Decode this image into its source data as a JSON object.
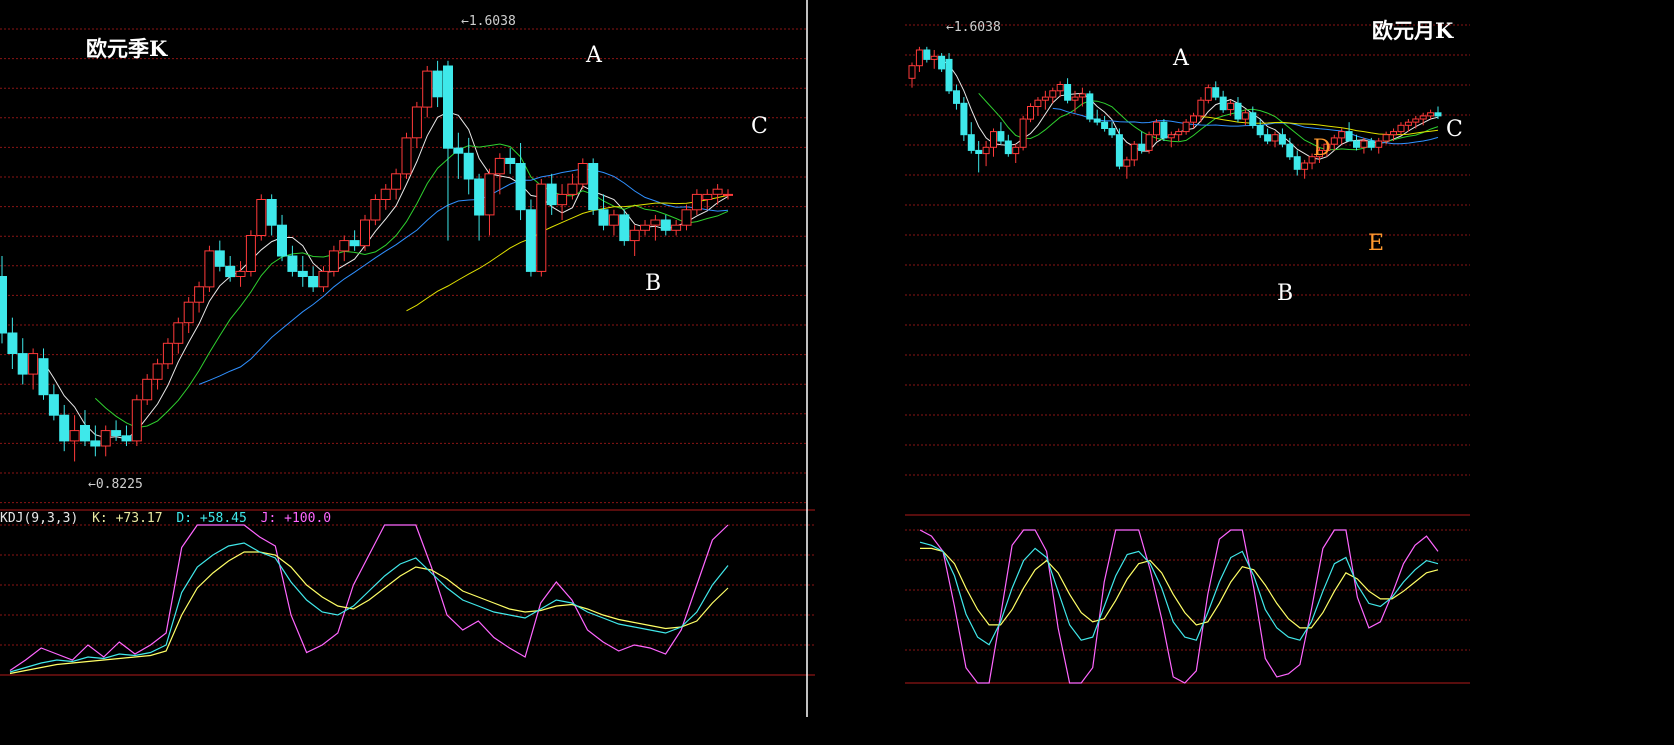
{
  "colors": {
    "up": "#ff3a3a",
    "down": "#3ee8ea",
    "ma5": "#e8e8e8",
    "ma10": "#f0f000",
    "ma20": "#2fd02f",
    "ma30": "#2f90ff",
    "ma60": "#e0e000",
    "k": "#e8e8e8",
    "d": "#ffff66",
    "j": "#ff66ff",
    "grid": "#8a1515",
    "divider": "#ffffff",
    "annot": "#ffffff",
    "annot_orange": "#ff9a2e"
  },
  "chart_data": [
    {
      "type": "candlestick",
      "title": "欧元季K",
      "price_high_label": "1.6038",
      "price_low_label": "0.8225",
      "ylim": [
        0.78,
        1.66
      ],
      "candles": [
        [
          1.18,
          1.22,
          1.05,
          1.07
        ],
        [
          1.07,
          1.1,
          1.0,
          1.03
        ],
        [
          1.03,
          1.06,
          0.97,
          0.99
        ],
        [
          0.99,
          1.04,
          0.96,
          1.03
        ],
        [
          1.02,
          1.04,
          0.94,
          0.95
        ],
        [
          0.95,
          0.97,
          0.9,
          0.91
        ],
        [
          0.91,
          0.93,
          0.84,
          0.86
        ],
        [
          0.86,
          0.91,
          0.82,
          0.88
        ],
        [
          0.89,
          0.92,
          0.85,
          0.86
        ],
        [
          0.86,
          0.89,
          0.83,
          0.85
        ],
        [
          0.85,
          0.89,
          0.83,
          0.88
        ],
        [
          0.88,
          0.9,
          0.86,
          0.87
        ],
        [
          0.87,
          0.89,
          0.85,
          0.86
        ],
        [
          0.86,
          0.95,
          0.85,
          0.94
        ],
        [
          0.94,
          0.99,
          0.93,
          0.98
        ],
        [
          0.98,
          1.02,
          0.96,
          1.01
        ],
        [
          1.01,
          1.06,
          1.0,
          1.05
        ],
        [
          1.05,
          1.1,
          1.03,
          1.09
        ],
        [
          1.09,
          1.14,
          1.07,
          1.13
        ],
        [
          1.13,
          1.17,
          1.11,
          1.16
        ],
        [
          1.16,
          1.24,
          1.15,
          1.23
        ],
        [
          1.23,
          1.25,
          1.19,
          1.2
        ],
        [
          1.2,
          1.22,
          1.17,
          1.18
        ],
        [
          1.18,
          1.21,
          1.16,
          1.19
        ],
        [
          1.19,
          1.27,
          1.18,
          1.26
        ],
        [
          1.26,
          1.34,
          1.25,
          1.33
        ],
        [
          1.33,
          1.34,
          1.26,
          1.28
        ],
        [
          1.28,
          1.3,
          1.21,
          1.22
        ],
        [
          1.22,
          1.24,
          1.18,
          1.19
        ],
        [
          1.19,
          1.22,
          1.16,
          1.18
        ],
        [
          1.18,
          1.2,
          1.15,
          1.16
        ],
        [
          1.16,
          1.2,
          1.15,
          1.19
        ],
        [
          1.19,
          1.24,
          1.18,
          1.23
        ],
        [
          1.23,
          1.26,
          1.21,
          1.25
        ],
        [
          1.25,
          1.27,
          1.23,
          1.24
        ],
        [
          1.24,
          1.3,
          1.23,
          1.29
        ],
        [
          1.29,
          1.34,
          1.28,
          1.33
        ],
        [
          1.33,
          1.36,
          1.31,
          1.35
        ],
        [
          1.35,
          1.39,
          1.33,
          1.38
        ],
        [
          1.38,
          1.46,
          1.37,
          1.45
        ],
        [
          1.45,
          1.52,
          1.43,
          1.51
        ],
        [
          1.51,
          1.59,
          1.49,
          1.58
        ],
        [
          1.58,
          1.6,
          1.51,
          1.53
        ],
        [
          1.59,
          1.6,
          1.25,
          1.43
        ],
        [
          1.43,
          1.46,
          1.37,
          1.42
        ],
        [
          1.42,
          1.45,
          1.34,
          1.37
        ],
        [
          1.37,
          1.38,
          1.25,
          1.3
        ],
        [
          1.3,
          1.39,
          1.26,
          1.38
        ],
        [
          1.38,
          1.42,
          1.34,
          1.41
        ],
        [
          1.41,
          1.43,
          1.38,
          1.4
        ],
        [
          1.4,
          1.44,
          1.29,
          1.31
        ],
        [
          1.31,
          1.33,
          1.18,
          1.19
        ],
        [
          1.19,
          1.37,
          1.18,
          1.36
        ],
        [
          1.36,
          1.38,
          1.3,
          1.32
        ],
        [
          1.32,
          1.36,
          1.29,
          1.34
        ],
        [
          1.34,
          1.38,
          1.33,
          1.36
        ],
        [
          1.36,
          1.41,
          1.35,
          1.4
        ],
        [
          1.4,
          1.41,
          1.3,
          1.31
        ],
        [
          1.31,
          1.34,
          1.27,
          1.28
        ],
        [
          1.28,
          1.31,
          1.26,
          1.3
        ],
        [
          1.3,
          1.31,
          1.24,
          1.25
        ],
        [
          1.25,
          1.28,
          1.22,
          1.27
        ],
        [
          1.27,
          1.29,
          1.26,
          1.28
        ],
        [
          1.28,
          1.3,
          1.25,
          1.29
        ],
        [
          1.29,
          1.3,
          1.26,
          1.27
        ],
        [
          1.27,
          1.29,
          1.26,
          1.28
        ],
        [
          1.28,
          1.32,
          1.27,
          1.31
        ],
        [
          1.31,
          1.35,
          1.3,
          1.34
        ],
        [
          1.33,
          1.35,
          1.31,
          1.34
        ],
        [
          1.34,
          1.36,
          1.32,
          1.35
        ],
        [
          1.34,
          1.35,
          1.33,
          1.34
        ]
      ],
      "annotations": [
        "A",
        "B",
        "C"
      ],
      "kdj_label": "KDJ(9,3,3)",
      "kdj_k_label": "K: +73.17",
      "kdj_d_label": "D: +58.45",
      "kdj_j_label": "J: +100.0",
      "kdj": {
        "k": [
          2,
          5,
          8,
          10,
          9,
          12,
          11,
          14,
          13,
          15,
          20,
          55,
          72,
          80,
          86,
          88,
          82,
          78,
          62,
          50,
          42,
          40,
          46,
          56,
          66,
          74,
          78,
          68,
          58,
          50,
          46,
          42,
          40,
          38,
          44,
          50,
          48,
          42,
          38,
          34,
          32,
          30,
          28,
          32,
          42,
          60,
          73
        ],
        "d": [
          1,
          3,
          5,
          7,
          8,
          9,
          10,
          11,
          12,
          13,
          16,
          40,
          58,
          68,
          76,
          82,
          82,
          80,
          72,
          60,
          52,
          46,
          44,
          50,
          58,
          66,
          72,
          70,
          64,
          56,
          52,
          48,
          44,
          42,
          43,
          46,
          47,
          44,
          40,
          37,
          35,
          33,
          31,
          32,
          36,
          48,
          58
        ],
        "j": [
          3,
          10,
          18,
          14,
          10,
          20,
          12,
          22,
          14,
          20,
          28,
          85,
          100,
          100,
          100,
          100,
          92,
          86,
          40,
          15,
          20,
          28,
          60,
          80,
          100,
          100,
          100,
          72,
          40,
          30,
          36,
          25,
          18,
          12,
          48,
          62,
          50,
          30,
          22,
          16,
          20,
          18,
          14,
          30,
          60,
          90,
          100
        ]
      }
    },
    {
      "type": "candlestick",
      "title": "欧元月K",
      "price_high_label": "1.6038",
      "ylim": [
        0.8,
        1.66
      ],
      "candles": [
        [
          1.5,
          1.55,
          1.47,
          1.54
        ],
        [
          1.54,
          1.6,
          1.52,
          1.59
        ],
        [
          1.59,
          1.6,
          1.55,
          1.56
        ],
        [
          1.56,
          1.59,
          1.53,
          1.57
        ],
        [
          1.57,
          1.58,
          1.52,
          1.53
        ],
        [
          1.56,
          1.58,
          1.45,
          1.46
        ],
        [
          1.46,
          1.48,
          1.4,
          1.42
        ],
        [
          1.42,
          1.44,
          1.3,
          1.32
        ],
        [
          1.32,
          1.36,
          1.26,
          1.27
        ],
        [
          1.27,
          1.3,
          1.2,
          1.26
        ],
        [
          1.26,
          1.3,
          1.22,
          1.28
        ],
        [
          1.28,
          1.34,
          1.25,
          1.33
        ],
        [
          1.33,
          1.36,
          1.29,
          1.3
        ],
        [
          1.3,
          1.32,
          1.25,
          1.26
        ],
        [
          1.26,
          1.29,
          1.23,
          1.28
        ],
        [
          1.28,
          1.38,
          1.27,
          1.37
        ],
        [
          1.37,
          1.42,
          1.36,
          1.41
        ],
        [
          1.41,
          1.44,
          1.38,
          1.43
        ],
        [
          1.43,
          1.46,
          1.4,
          1.44
        ],
        [
          1.44,
          1.47,
          1.42,
          1.46
        ],
        [
          1.46,
          1.49,
          1.44,
          1.48
        ],
        [
          1.48,
          1.5,
          1.42,
          1.43
        ],
        [
          1.43,
          1.46,
          1.39,
          1.44
        ],
        [
          1.44,
          1.47,
          1.41,
          1.45
        ],
        [
          1.45,
          1.46,
          1.36,
          1.37
        ],
        [
          1.37,
          1.4,
          1.35,
          1.36
        ],
        [
          1.36,
          1.38,
          1.33,
          1.34
        ],
        [
          1.34,
          1.36,
          1.31,
          1.32
        ],
        [
          1.32,
          1.34,
          1.21,
          1.22
        ],
        [
          1.22,
          1.25,
          1.18,
          1.24
        ],
        [
          1.24,
          1.3,
          1.22,
          1.29
        ],
        [
          1.29,
          1.33,
          1.26,
          1.27
        ],
        [
          1.27,
          1.33,
          1.26,
          1.32
        ],
        [
          1.32,
          1.37,
          1.3,
          1.36
        ],
        [
          1.36,
          1.37,
          1.3,
          1.31
        ],
        [
          1.31,
          1.33,
          1.28,
          1.32
        ],
        [
          1.32,
          1.34,
          1.3,
          1.33
        ],
        [
          1.33,
          1.37,
          1.32,
          1.36
        ],
        [
          1.36,
          1.39,
          1.34,
          1.38
        ],
        [
          1.38,
          1.44,
          1.36,
          1.43
        ],
        [
          1.43,
          1.48,
          1.42,
          1.47
        ],
        [
          1.47,
          1.49,
          1.43,
          1.44
        ],
        [
          1.44,
          1.46,
          1.39,
          1.4
        ],
        [
          1.4,
          1.43,
          1.38,
          1.42
        ],
        [
          1.42,
          1.44,
          1.36,
          1.37
        ],
        [
          1.37,
          1.4,
          1.35,
          1.39
        ],
        [
          1.39,
          1.41,
          1.34,
          1.35
        ],
        [
          1.35,
          1.37,
          1.31,
          1.32
        ],
        [
          1.32,
          1.34,
          1.29,
          1.3
        ],
        [
          1.3,
          1.33,
          1.28,
          1.32
        ],
        [
          1.32,
          1.34,
          1.28,
          1.29
        ],
        [
          1.29,
          1.31,
          1.24,
          1.25
        ],
        [
          1.25,
          1.27,
          1.19,
          1.21
        ],
        [
          1.21,
          1.24,
          1.18,
          1.23
        ],
        [
          1.23,
          1.26,
          1.21,
          1.25
        ],
        [
          1.25,
          1.28,
          1.23,
          1.27
        ],
        [
          1.27,
          1.3,
          1.25,
          1.29
        ],
        [
          1.29,
          1.32,
          1.27,
          1.31
        ],
        [
          1.31,
          1.34,
          1.29,
          1.33
        ],
        [
          1.33,
          1.36,
          1.3,
          1.3
        ],
        [
          1.3,
          1.32,
          1.27,
          1.28
        ],
        [
          1.28,
          1.31,
          1.26,
          1.3
        ],
        [
          1.3,
          1.31,
          1.27,
          1.28
        ],
        [
          1.28,
          1.31,
          1.26,
          1.3
        ],
        [
          1.3,
          1.33,
          1.29,
          1.32
        ],
        [
          1.32,
          1.34,
          1.3,
          1.33
        ],
        [
          1.33,
          1.36,
          1.32,
          1.35
        ],
        [
          1.35,
          1.37,
          1.33,
          1.36
        ],
        [
          1.36,
          1.38,
          1.34,
          1.37
        ],
        [
          1.37,
          1.39,
          1.35,
          1.38
        ],
        [
          1.38,
          1.4,
          1.37,
          1.39
        ],
        [
          1.39,
          1.41,
          1.37,
          1.38
        ]
      ],
      "annotations": [
        "A",
        "B",
        "C",
        "D",
        "E"
      ],
      "kdj": {
        "k": [
          92,
          90,
          86,
          70,
          45,
          30,
          25,
          40,
          62,
          80,
          88,
          82,
          60,
          38,
          28,
          30,
          50,
          70,
          84,
          86,
          78,
          62,
          40,
          30,
          28,
          46,
          66,
          82,
          86,
          70,
          48,
          36,
          30,
          28,
          40,
          60,
          78,
          82,
          64,
          52,
          50,
          56,
          66,
          74,
          80,
          78
        ],
        "d": [
          88,
          88,
          86,
          78,
          62,
          48,
          38,
          38,
          48,
          62,
          74,
          80,
          72,
          58,
          46,
          40,
          42,
          54,
          68,
          78,
          80,
          72,
          58,
          46,
          38,
          40,
          52,
          66,
          76,
          74,
          64,
          52,
          42,
          36,
          36,
          46,
          60,
          72,
          68,
          60,
          55,
          55,
          60,
          66,
          72,
          74
        ],
        "j": [
          100,
          96,
          86,
          50,
          10,
          0,
          0,
          44,
          90,
          100,
          100,
          86,
          36,
          0,
          0,
          10,
          66,
          100,
          100,
          100,
          74,
          42,
          4,
          0,
          8,
          58,
          94,
          100,
          100,
          62,
          16,
          4,
          6,
          12,
          48,
          88,
          100,
          100,
          56,
          36,
          40,
          58,
          78,
          90,
          96,
          86
        ]
      }
    }
  ]
}
